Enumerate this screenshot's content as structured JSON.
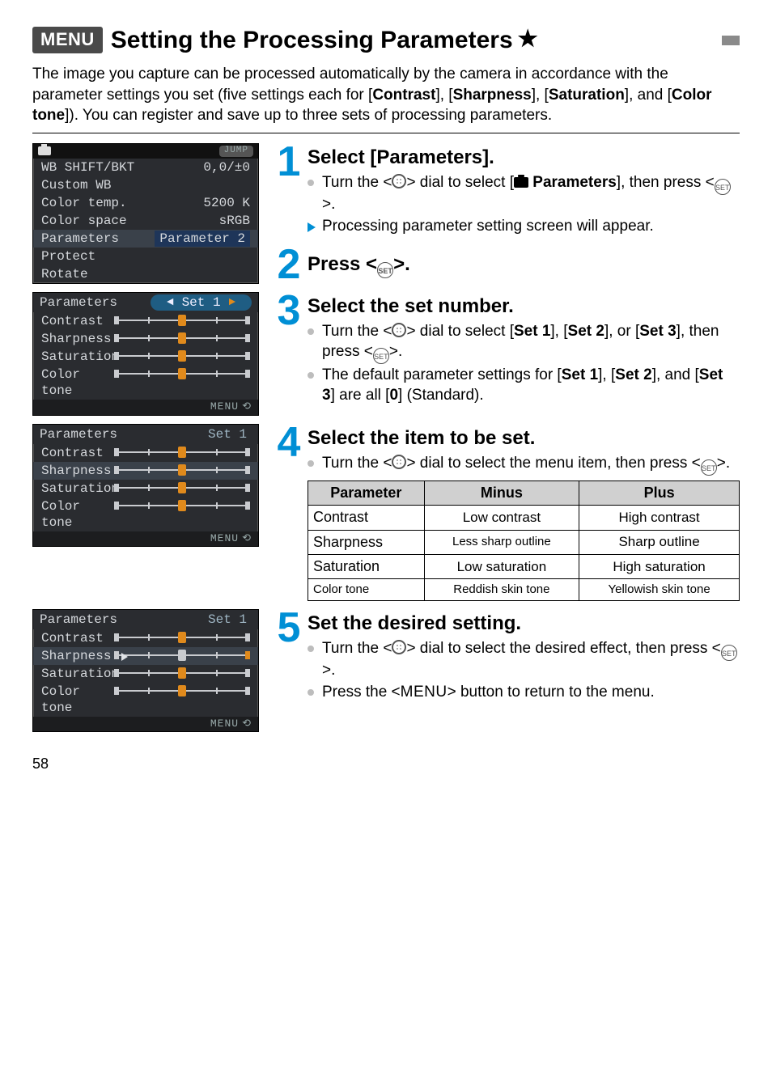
{
  "page_number": "58",
  "heading": {
    "menu_badge": "MENU",
    "title": "Setting the Processing Parameters",
    "star": "★"
  },
  "intro_html": "The image you capture can be processed automatically by the camera in accordance with the parameter settings you set (five settings each for [<b>Contrast</b>], [<b>Sharpness</b>], [<b>Saturation</b>], and [<b>Color tone</b>]). You can register and save up to three sets of processing parameters.",
  "lcd1": {
    "topbar_jump": "JUMP",
    "rows": [
      {
        "label": "WB SHIFT/BKT",
        "value": "0,0/±0"
      },
      {
        "label": "Custom WB",
        "value": ""
      },
      {
        "label": "Color temp.",
        "value": "5200 K"
      },
      {
        "label": "Color space",
        "value": "sRGB"
      },
      {
        "label": "Parameters",
        "value": "Parameter 2",
        "selected": true
      },
      {
        "label": "Protect",
        "value": ""
      },
      {
        "label": "Rotate",
        "value": ""
      }
    ]
  },
  "lcd_params_common": {
    "title": "Parameters",
    "labels": [
      "Contrast",
      "Sharpness",
      "Saturation",
      "Color tone"
    ],
    "footer": "MENU"
  },
  "lcd2_set": "Set 1",
  "lcd3_set": "Set 1",
  "lcd4_set": "Set 1",
  "step1": {
    "num": "1",
    "title": "Select [Parameters].",
    "b1_pre": "Turn the <",
    "b1_mid": "> dial to select [",
    "b1_param": "Parameters",
    "b1_after": "], then press <",
    "b1_end": ">.",
    "b2": "Processing parameter setting screen will appear."
  },
  "step2": {
    "num": "2",
    "title_pre": "Press <",
    "title_post": ">."
  },
  "step3": {
    "num": "3",
    "title": "Select the set number.",
    "b1_pre": "Turn the <",
    "b1_mid": "> dial to select [",
    "b1_s1": "Set 1",
    "b1_mid2": "], [",
    "b1_s2": "Set 2",
    "b1_mid3": "], or [",
    "b1_s3": "Set 3",
    "b1_after": "], then press <",
    "b1_end": ">.",
    "b2_pre": "The default parameter settings for [",
    "b2_s1": "Set 1",
    "b2_m1": "], [",
    "b2_s2": "Set 2",
    "b2_m2": "], and [",
    "b2_s3": "Set 3",
    "b2_after": "] are all [",
    "b2_zero": "0",
    "b2_end": "] (Standard)."
  },
  "step4": {
    "num": "4",
    "title": "Select the item to be set.",
    "b1_pre": "Turn the <",
    "b1_mid": "> dial to select the menu item, then press <",
    "b1_end": ">."
  },
  "param_table": {
    "headers": [
      "Parameter",
      "Minus",
      "Plus"
    ],
    "rows": [
      [
        "Contrast",
        "Low contrast",
        "High contrast"
      ],
      [
        "Sharpness",
        "Less sharp outline",
        "Sharp outline"
      ],
      [
        "Saturation",
        "Low saturation",
        "High saturation"
      ],
      [
        "Color tone",
        "Reddish skin tone",
        "Yellowish skin tone"
      ]
    ]
  },
  "step5": {
    "num": "5",
    "title": "Set the desired setting.",
    "b1_pre": "Turn the <",
    "b1_mid": "> dial to select the desired effect, then press <",
    "b1_end": ">.",
    "b2_pre": "Press the <",
    "b2_menu": "MENU",
    "b2_post": ">  button to return to the menu."
  }
}
